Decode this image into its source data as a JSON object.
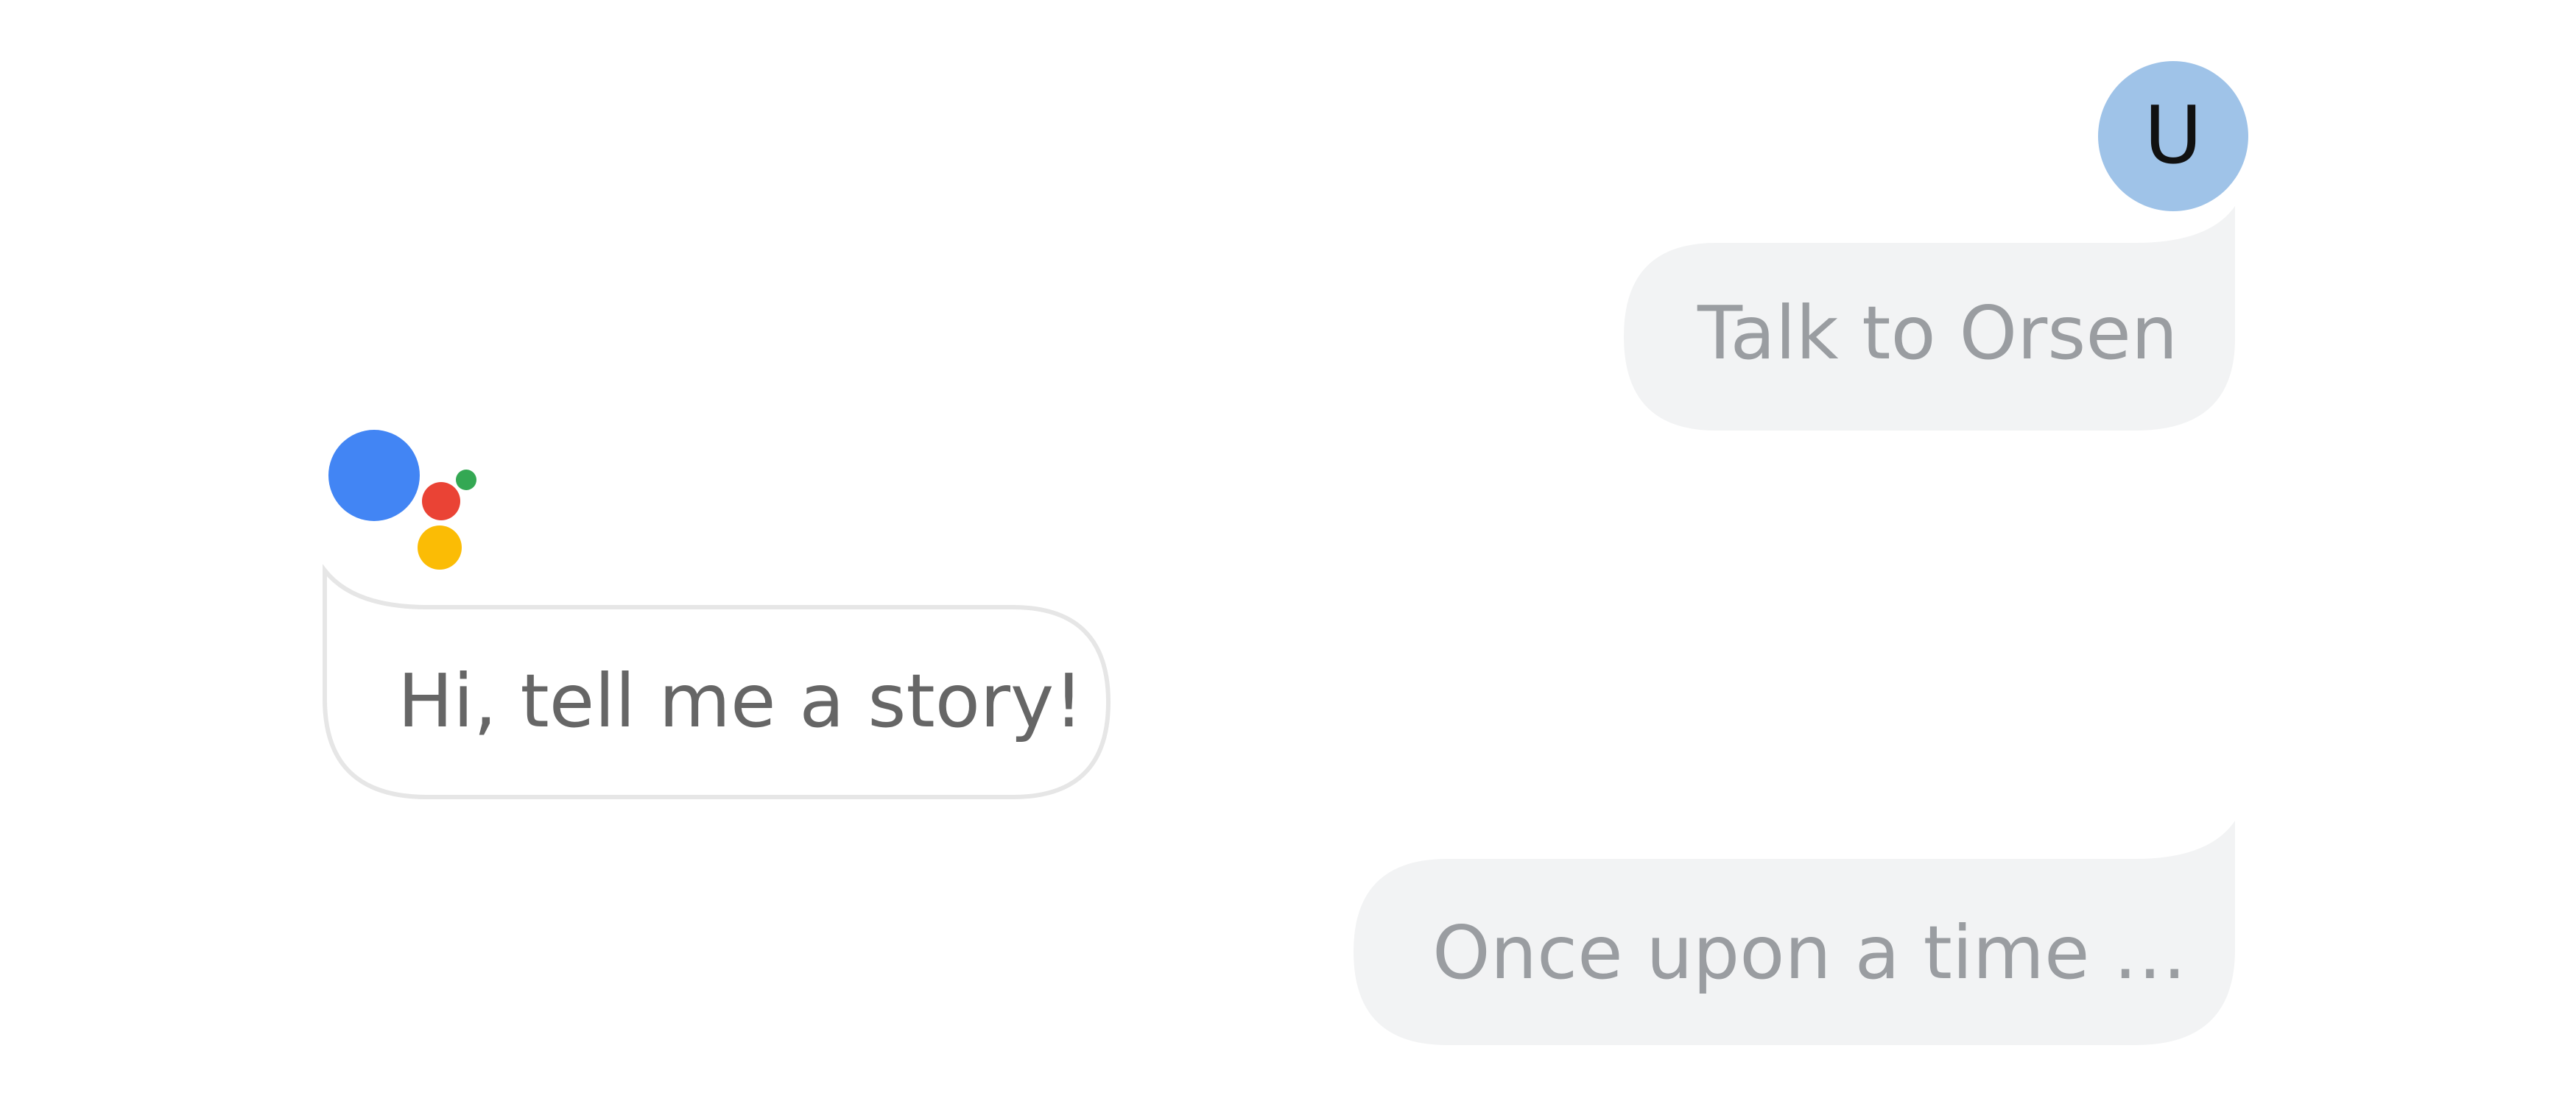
{
  "user": {
    "avatar_letter": "U"
  },
  "messages": [
    {
      "sender": "user",
      "text": "Talk to Orsen"
    },
    {
      "sender": "assistant",
      "text": "Hi, tell me a story!"
    },
    {
      "sender": "user",
      "text": "Once upon a time …"
    }
  ],
  "colors": {
    "user_bubble": "#f2f3f4",
    "user_text": "#9a9da1",
    "assistant_bubble": "#ffffff",
    "assistant_border": "#e6e6e6",
    "assistant_text": "#666666",
    "avatar_bg": "#9fc3e8",
    "assistant_blue": "#4285f4",
    "assistant_red": "#ea4335",
    "assistant_yellow": "#fbbc05",
    "assistant_green": "#34a853"
  },
  "icons": {
    "assistant_logo": "google-assistant-dots-icon"
  }
}
